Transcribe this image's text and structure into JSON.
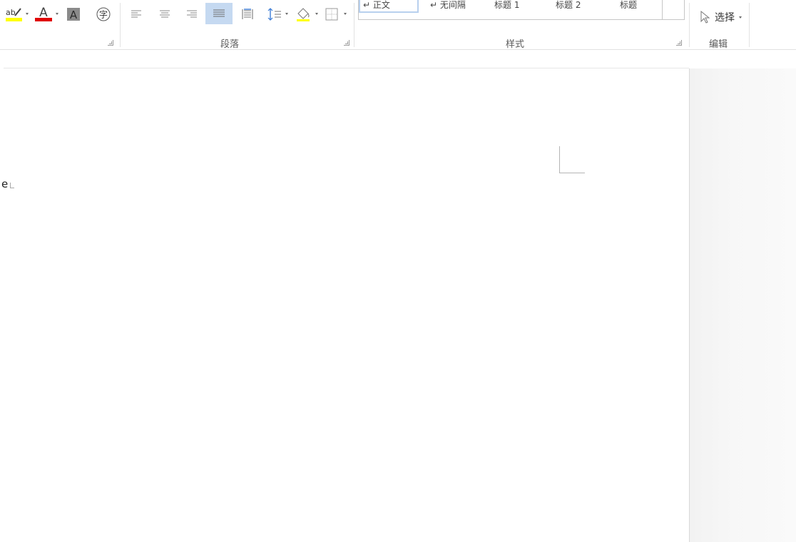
{
  "ribbon": {
    "groups": {
      "paragraph": "段落",
      "styles": "样式",
      "editing": "编辑"
    },
    "tools": {
      "highlight": "text-highlight-color",
      "font_color": "font-color",
      "char_shading": "character-shading",
      "enclose_char": "enclose-characters",
      "enclose_char_glyph": "字",
      "font_color_glyph": "A",
      "char_shading_glyph": "A",
      "highlight_glyph": "ab"
    },
    "styles_gallery": [
      {
        "label": "↵ 正文",
        "selected": true
      },
      {
        "label": "↵ 无间隔",
        "selected": false
      },
      {
        "label": "标题 1",
        "selected": false
      },
      {
        "label": "标题 2",
        "selected": false
      },
      {
        "label": "标题",
        "selected": false
      }
    ],
    "select_button": "选择",
    "colors": {
      "highlight_bar": "#ffff00",
      "font_color_bar": "#e00000",
      "active_button_bg": "#c5d9f1",
      "ribbon_border": "#e1e1e1"
    }
  },
  "document": {
    "visible_text": "e"
  }
}
